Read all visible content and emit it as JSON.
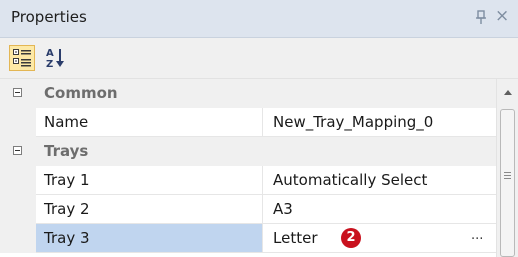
{
  "panel": {
    "title": "Properties",
    "pin_icon": "pin-icon",
    "close_glyph": "×"
  },
  "toolbar": {
    "categorized_icon": "categorized-view-icon",
    "alphabetical_icon": "sort-alphabetical-icon"
  },
  "grid": {
    "categories": [
      {
        "label": "Common"
      },
      {
        "label": "Trays"
      }
    ],
    "rows": [
      {
        "name": "Name",
        "value": "New_Tray_Mapping_0"
      },
      {
        "name": "Tray 1",
        "value": "Automatically Select"
      },
      {
        "name": "Tray 2",
        "value": "A3"
      },
      {
        "name": "Tray 3",
        "value": "Letter",
        "badge": "2",
        "ellipsis": "..."
      }
    ]
  },
  "colors": {
    "titlebar": "#dde4ee",
    "selected_row": "#c0d5ef",
    "badge": "#c9111e",
    "category_text": "#6d6d6d"
  }
}
